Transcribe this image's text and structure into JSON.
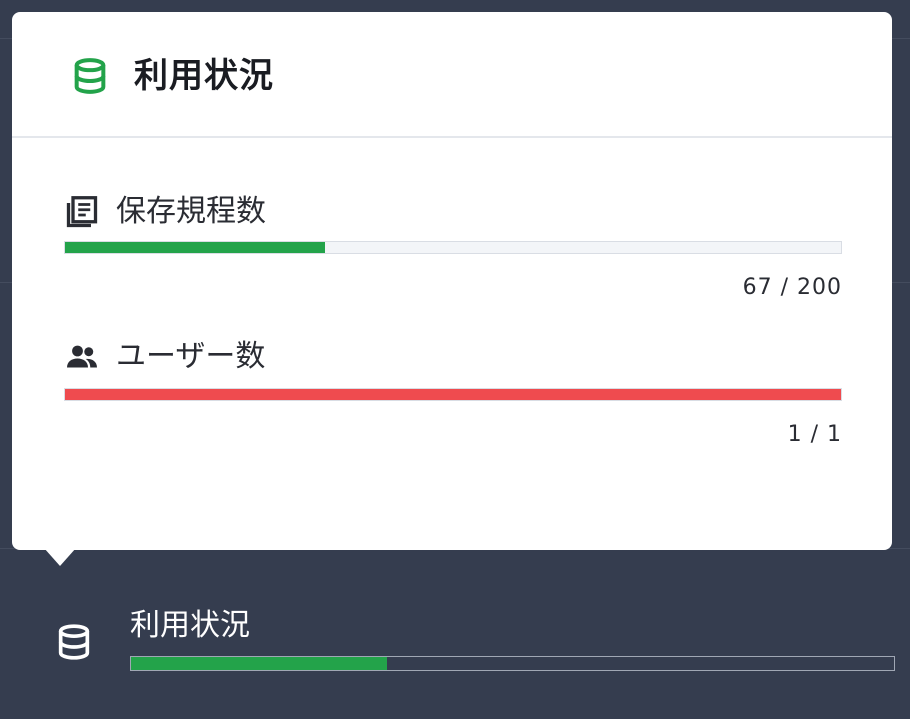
{
  "colors": {
    "accent_green": "#23a34a",
    "danger_red": "#ef4b4f",
    "sidebar_bg": "#353d4f"
  },
  "popover": {
    "icon": "database-icon",
    "title": "利用状況",
    "stats": [
      {
        "icon": "document-list-icon",
        "label": "保存規程数",
        "count_text": "67 / 200",
        "used": 67,
        "total": 200,
        "bar_color": "#23a34a"
      },
      {
        "icon": "users-icon",
        "label": "ユーザー数",
        "count_text": "1 / 1",
        "used": 1,
        "total": 1,
        "bar_color": "#ef4b4f"
      }
    ]
  },
  "sidebar": {
    "usage_item": {
      "icon": "database-icon",
      "label": "利用状況",
      "progress_fraction": 0.335,
      "bar_color": "#23a34a"
    }
  }
}
